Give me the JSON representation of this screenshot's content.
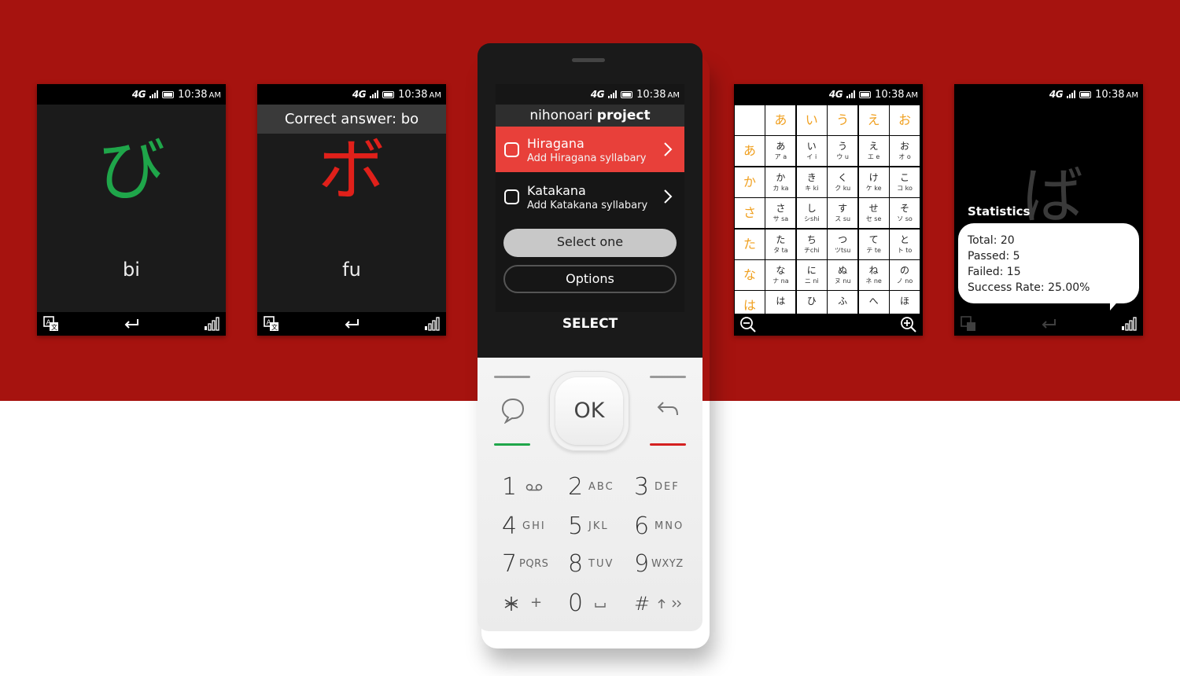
{
  "status": {
    "network": "4G",
    "time": "10:38",
    "ampm": "AM"
  },
  "screen1": {
    "kana": "び",
    "kana_color": "#1fa64a",
    "romaji": "bi",
    "icons": [
      "translate-icon",
      "enter-icon",
      "signal-icon"
    ]
  },
  "screen2": {
    "answer": "Correct answer: bo",
    "kana": "ボ",
    "kana_color": "#e0201a",
    "romaji": "fu",
    "icons": [
      "translate-icon",
      "enter-icon",
      "signal-icon"
    ]
  },
  "menu": {
    "title_plain": "nihonoari ",
    "title_bold": "project",
    "items": [
      {
        "title": "Hiragana",
        "subtitle": "Add Hiragana syllabary",
        "active": true
      },
      {
        "title": "Katakana",
        "subtitle": "Add Katakana syllabary",
        "active": false
      }
    ],
    "select_button": "Select one",
    "options_button": "Options",
    "softkey_center": "SELECT",
    "accent": "#e8403a"
  },
  "keypad": {
    "ok": "OK",
    "keys": [
      {
        "num": "1",
        "letters": ""
      },
      {
        "num": "2",
        "letters": "ABC"
      },
      {
        "num": "3",
        "letters": "DEF"
      },
      {
        "num": "4",
        "letters": "GHI"
      },
      {
        "num": "5",
        "letters": "JKL"
      },
      {
        "num": "6",
        "letters": "MNO"
      },
      {
        "num": "7",
        "letters": "PQRS"
      },
      {
        "num": "8",
        "letters": "TUV"
      },
      {
        "num": "9",
        "letters": "WXYZ"
      },
      {
        "num": "+",
        "letters": ""
      },
      {
        "num": "0",
        "letters": ""
      },
      {
        "num": "#",
        "letters": ""
      }
    ]
  },
  "table": {
    "header_row": [
      "",
      "あ",
      "い",
      "う",
      "え",
      "お"
    ],
    "rows": [
      {
        "head": "あ",
        "cells": [
          [
            "あ",
            "ア a"
          ],
          [
            "い",
            "イ i"
          ],
          [
            "う",
            "ウ u"
          ],
          [
            "え",
            "エ e"
          ],
          [
            "お",
            "オ o"
          ]
        ]
      },
      {
        "head": "か",
        "cells": [
          [
            "か",
            "カ ka"
          ],
          [
            "き",
            "キ ki"
          ],
          [
            "く",
            "ク ku"
          ],
          [
            "け",
            "ケ ke"
          ],
          [
            "こ",
            "コ ko"
          ]
        ]
      },
      {
        "head": "さ",
        "cells": [
          [
            "さ",
            "サ sa"
          ],
          [
            "し",
            "シshi"
          ],
          [
            "す",
            "ス su"
          ],
          [
            "せ",
            "セ se"
          ],
          [
            "そ",
            "ソ so"
          ]
        ]
      },
      {
        "head": "た",
        "cells": [
          [
            "た",
            "タ ta"
          ],
          [
            "ち",
            "チchi"
          ],
          [
            "つ",
            "ツtsu"
          ],
          [
            "て",
            "テ te"
          ],
          [
            "と",
            "ト to"
          ]
        ]
      },
      {
        "head": "な",
        "cells": [
          [
            "な",
            "ナ na"
          ],
          [
            "に",
            "ニ ni"
          ],
          [
            "ぬ",
            "ヌ nu"
          ],
          [
            "ね",
            "ネ ne"
          ],
          [
            "の",
            "ノ no"
          ]
        ]
      },
      {
        "head": "は",
        "cells": [
          [
            "は",
            ""
          ],
          [
            "ひ",
            ""
          ],
          [
            "ふ",
            ""
          ],
          [
            "へ",
            ""
          ],
          [
            "ほ",
            ""
          ]
        ]
      }
    ],
    "header_color": "#f0a020"
  },
  "stats": {
    "bg_kana": "ば",
    "title": "Statistics",
    "total": "Total: 20",
    "passed": "Passed: 5",
    "failed": "Failed: 15",
    "rate": "Success Rate: 25.00%"
  },
  "colors": {
    "background_red": "#a6130f",
    "call_green": "#1fa64a",
    "end_red": "#d42020"
  }
}
